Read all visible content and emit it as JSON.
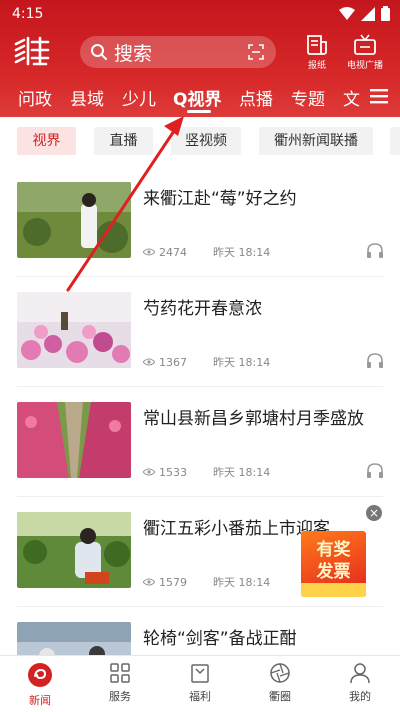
{
  "status_bar": {
    "time": "4:15",
    "icons": [
      "wifi-icon",
      "signal-icon",
      "battery-icon"
    ]
  },
  "header": {
    "logo_icon": "app-logo",
    "search": {
      "placeholder": "搜索",
      "icon": "search-icon",
      "scan_icon": "scan-icon"
    },
    "buttons": [
      {
        "label": "报纸",
        "icon": "newspaper-icon"
      },
      {
        "label": "电视广播",
        "icon": "tv-icon"
      }
    ]
  },
  "nav_tabs": [
    {
      "label": "问政",
      "active": false
    },
    {
      "label": "县域",
      "active": false
    },
    {
      "label": "少儿",
      "active": false
    },
    {
      "label": "Q视界",
      "active": true
    },
    {
      "label": "点播",
      "active": false
    },
    {
      "label": "专题",
      "active": false
    },
    {
      "label": "文",
      "active": false
    }
  ],
  "sub_tabs": [
    {
      "label": "视界",
      "active": true
    },
    {
      "label": "直播",
      "active": false
    },
    {
      "label": "竖视频",
      "active": false
    },
    {
      "label": "衢州新闻联播",
      "active": false
    }
  ],
  "articles": [
    {
      "title": "来衢江赴“莓”好之约",
      "views": "2474",
      "time": "昨天 18:14"
    },
    {
      "title": "芍药花开春意浓",
      "views": "1367",
      "time": "昨天 18:14"
    },
    {
      "title": "常山县新昌乡郭塘村月季盛放",
      "views": "1533",
      "time": "昨天 18:14"
    },
    {
      "title": "衢江五彩小番茄上市迎客",
      "views": "1579",
      "time": "昨天 18:14"
    },
    {
      "title": "轮椅“剑客”备战正酣",
      "views": "",
      "time": ""
    }
  ],
  "floating_ad": {
    "line1": "有奖",
    "line2": "发票"
  },
  "bottom_nav": [
    {
      "label": "新闻",
      "active": true,
      "icon": "news-icon"
    },
    {
      "label": "服务",
      "active": false,
      "icon": "grid-icon"
    },
    {
      "label": "福利",
      "active": false,
      "icon": "gift-icon"
    },
    {
      "label": "衢圈",
      "active": false,
      "icon": "aperture-icon"
    },
    {
      "label": "我的",
      "active": false,
      "icon": "user-icon"
    }
  ],
  "colors": {
    "brand_red": "#d32222",
    "header_red": "#c4161c",
    "annotation_arrow": "#e02020"
  }
}
